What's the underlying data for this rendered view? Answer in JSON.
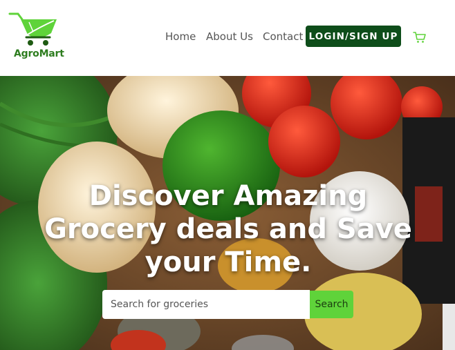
{
  "brand": {
    "name": "AgroMart",
    "logo_color": "#5fd33a",
    "text_color": "#2e7d1f"
  },
  "nav": {
    "home": "Home",
    "about": "About Us",
    "contact": "Contact",
    "login": "LOGIN/SIGN UP",
    "cart_icon": "cart-icon"
  },
  "hero": {
    "title": "Discover Amazing Grocery deals and Save your Time.",
    "search_placeholder": "Search for groceries",
    "search_button": "Search"
  },
  "colors": {
    "accent": "#5fd33a",
    "login_bg": "#0e4d1a"
  }
}
